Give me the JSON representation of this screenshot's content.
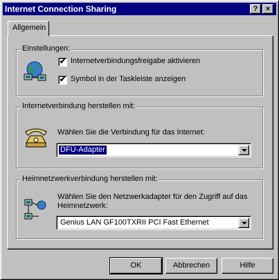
{
  "window": {
    "title": "Internet Connection Sharing",
    "help_glyph": "?",
    "close_glyph": "×"
  },
  "tabs": [
    {
      "label": "Allgemein",
      "active": true
    }
  ],
  "settings": {
    "group_label": "Einstellungen:",
    "icon": "network-globe-icon",
    "checkboxes": [
      {
        "label": "Internetverbindungsfreigabe aktivieren",
        "checked": true,
        "mark": "✔"
      },
      {
        "label": "Symbol in der Taskleiste anzeigen",
        "checked": true,
        "mark": "✔"
      }
    ]
  },
  "internet_connection": {
    "group_label": "Internetverbindung herstellen mit:",
    "icon": "telephone-icon",
    "prompt": "Wählen Sie die Verbindung für das Internet:",
    "selected": "DFÜ-Adapter"
  },
  "home_network": {
    "group_label": "Heimnetzwerkverbindung herstellen mit:",
    "icon": "network-computers-icon",
    "prompt_line1": "Wählen Sie den Netzwerkadapter für den Zugriff auf das",
    "prompt_line2": "Heimnetzwerk:",
    "selected": "Genius LAN GF100TXRII PCI Fast Ethernet"
  },
  "buttons": {
    "ok": "OK",
    "cancel": "Abbrechen",
    "help": "Hilfe"
  },
  "colors": {
    "titlebar": "#000080",
    "face": "#c0c0c0",
    "selection": "#000080"
  }
}
